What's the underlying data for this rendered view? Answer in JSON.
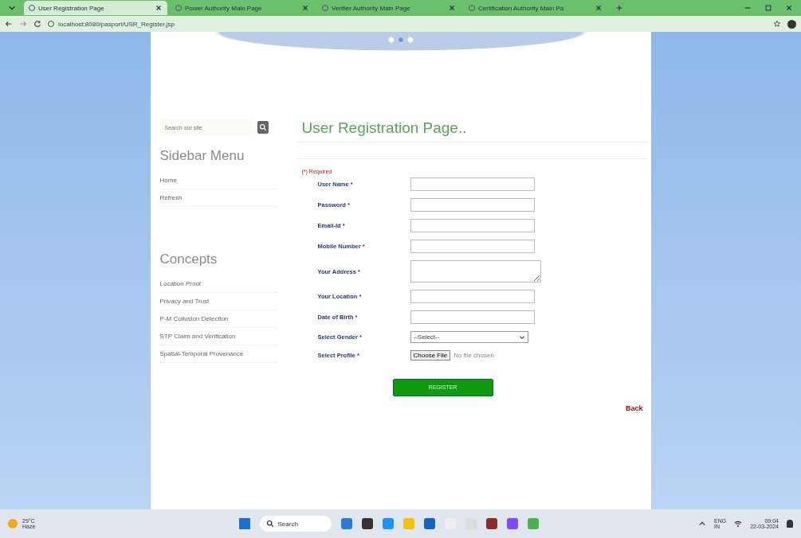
{
  "browser": {
    "tabs": [
      {
        "title": "User Registration Page",
        "selected": true
      },
      {
        "title": "Power Authority Main Page",
        "selected": false
      },
      {
        "title": "Verifier Authority Main Page",
        "selected": false
      },
      {
        "title": "Certification Authority Main Pa",
        "selected": false
      }
    ],
    "url": "localhost:8080/pasport/USR_Register.jsp"
  },
  "sidebar": {
    "search": {
      "placeholder": "Search our site"
    },
    "menu_title": "Sidebar Menu",
    "menu_items": [
      "Home",
      "Refresh"
    ],
    "concepts_title": "Concepts",
    "concepts": [
      "Location Proof",
      "Privacy and Trust",
      "P-M Collusion Detection",
      "STP Claim and Verification",
      "Spatial-Temporal Provenance"
    ]
  },
  "form": {
    "title": "User Registration Page..",
    "required_note": "(*) Required",
    "fields": [
      {
        "label": "User Name *",
        "kind": "text"
      },
      {
        "label": "Password *",
        "kind": "text"
      },
      {
        "label": "Email-Id *",
        "kind": "text"
      },
      {
        "label": "Mobile Number *",
        "kind": "text"
      },
      {
        "label": "Your Address *",
        "kind": "textarea"
      },
      {
        "label": "Your Location *",
        "kind": "text"
      },
      {
        "label": "Date of Birth *",
        "kind": "text"
      },
      {
        "label": "Select Gender *",
        "kind": "select",
        "value": "--Select--"
      },
      {
        "label": "Select Profile *",
        "kind": "file",
        "button": "Choose File",
        "value": "No file chosen"
      }
    ],
    "submit": "REGISTER",
    "back_link": "Back"
  },
  "taskbar": {
    "weather": {
      "temp": "29°C",
      "desc": "Haze"
    },
    "search_placeholder": "Search",
    "lang": [
      "ENG",
      "IN"
    ],
    "time": "09:04",
    "date": "22-03-2024"
  }
}
